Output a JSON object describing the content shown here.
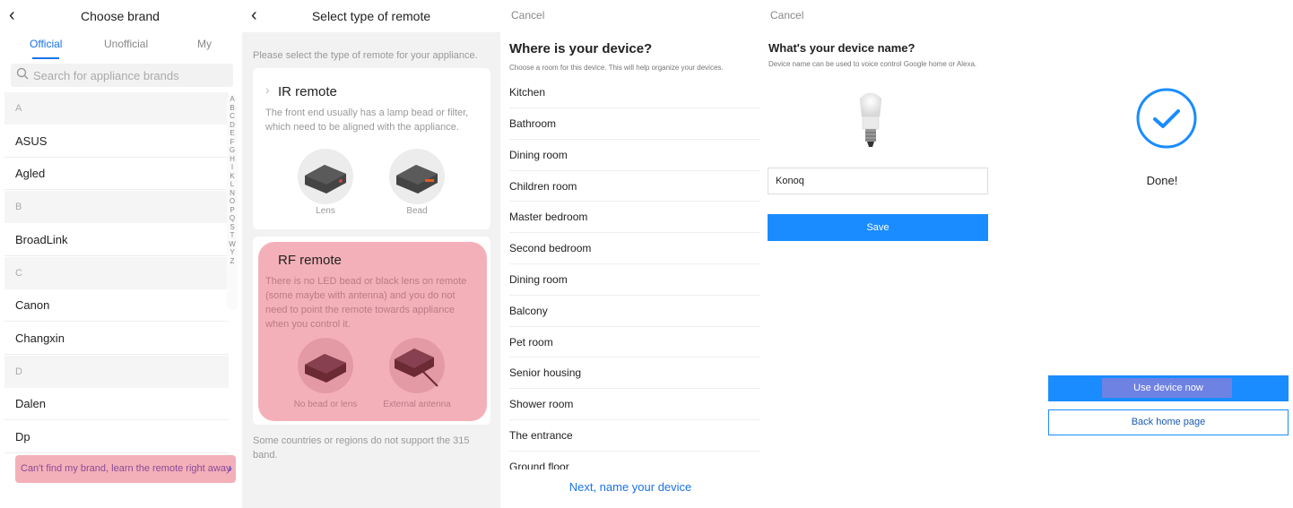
{
  "choose_brand": {
    "title": "Choose brand",
    "tabs": [
      "Official",
      "Unofficial",
      "My"
    ],
    "search_placeholder": "Search for appliance brands",
    "rows": [
      {
        "kind": "section",
        "label": "A"
      },
      {
        "kind": "item",
        "label": "ASUS"
      },
      {
        "kind": "item",
        "label": "Agled"
      },
      {
        "kind": "section",
        "label": "B"
      },
      {
        "kind": "item",
        "label": "BroadLink"
      },
      {
        "kind": "section",
        "label": "C"
      },
      {
        "kind": "item",
        "label": "Canon"
      },
      {
        "kind": "item",
        "label": "Changxin"
      },
      {
        "kind": "section",
        "label": "D"
      },
      {
        "kind": "item",
        "label": "Dalen"
      },
      {
        "kind": "item",
        "label": "Dp"
      }
    ],
    "alphabet": [
      "A",
      "B",
      "C",
      "D",
      "E",
      "F",
      "G",
      "H",
      "I",
      "K",
      "L",
      "N",
      "O",
      "P",
      "Q",
      "S",
      "T",
      "W",
      "Y",
      "Z"
    ],
    "cant_find": "Can't find my brand, learn the remote right away"
  },
  "remote_type": {
    "title": "Select type of remote",
    "hint": "Please select the type of remote for your appliance.",
    "ir": {
      "title": "IR remote",
      "desc": "The front end usually has a lamp bead or filter, which need to be aligned with the appliance.",
      "opt1": "Lens",
      "opt2": "Bead"
    },
    "rf": {
      "title": "RF remote",
      "desc": "There is no LED bead or black lens on remote (some maybe with antenna) and you do not need to point the remote towards appliance when you control it.",
      "opt1": "No bead or lens",
      "opt2": "External antenna"
    },
    "footnote": "Some countries or regions do not support the 315 band."
  },
  "room": {
    "cancel": "Cancel",
    "title": "Where is your device?",
    "subtitle": "Choose a room for this device. This will help organize your devices.",
    "rooms": [
      "Kitchen",
      "Bathroom",
      "Dining room",
      "Children room",
      "Master bedroom",
      "Second bedroom",
      "Dining room",
      "Balcony",
      "Pet room",
      "Senior housing",
      "Shower room",
      "The entrance",
      "Ground floor"
    ],
    "next": "Next, name your device"
  },
  "name": {
    "cancel": "Cancel",
    "title": "What's your device name?",
    "subtitle": "Device name can be used to voice control Google home or Alexa.",
    "value": "Konoq",
    "save": "Save"
  },
  "done": {
    "label": "Done!",
    "use_now": "Use device now",
    "back_home": "Back home page"
  },
  "colors": {
    "accent": "#1a8cff",
    "tab_active": "#1a73e8",
    "highlight": "#f4b0b8"
  }
}
